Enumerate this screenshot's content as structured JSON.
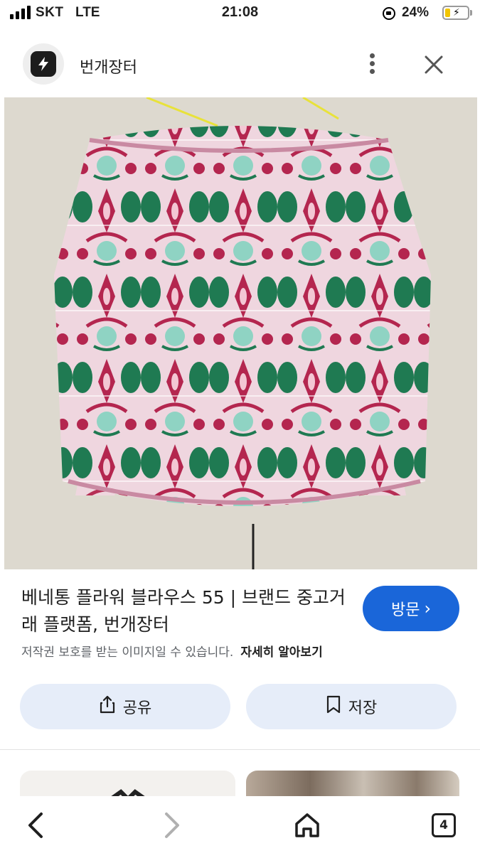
{
  "status_bar": {
    "carrier": "SKT",
    "network": "LTE",
    "time": "21:08",
    "battery_percent": "24%",
    "battery_level": 0.24,
    "battery_color": "#f2c500"
  },
  "header": {
    "app_name": "번개장터",
    "logo_icon": "lightning-bolt-icon",
    "more_icon": "more-vertical-icon",
    "close_icon": "close-icon"
  },
  "product": {
    "image_description_icon": "product-photo",
    "title": "베네통 플라워 블라우스 55 | 브랜드 중고거래 플랫폼, 번개장터",
    "visit_label": "방문",
    "copyright_notice": "저작권 보호를 받는 이미지일 수 있습니다.",
    "learn_more": "자세히 알아보기"
  },
  "actions": {
    "share_label": "공유",
    "save_label": "저장"
  },
  "nav": {
    "tab_count": "4"
  },
  "colors": {
    "accent": "#1a66d9",
    "action_bg": "#e6edf9"
  }
}
